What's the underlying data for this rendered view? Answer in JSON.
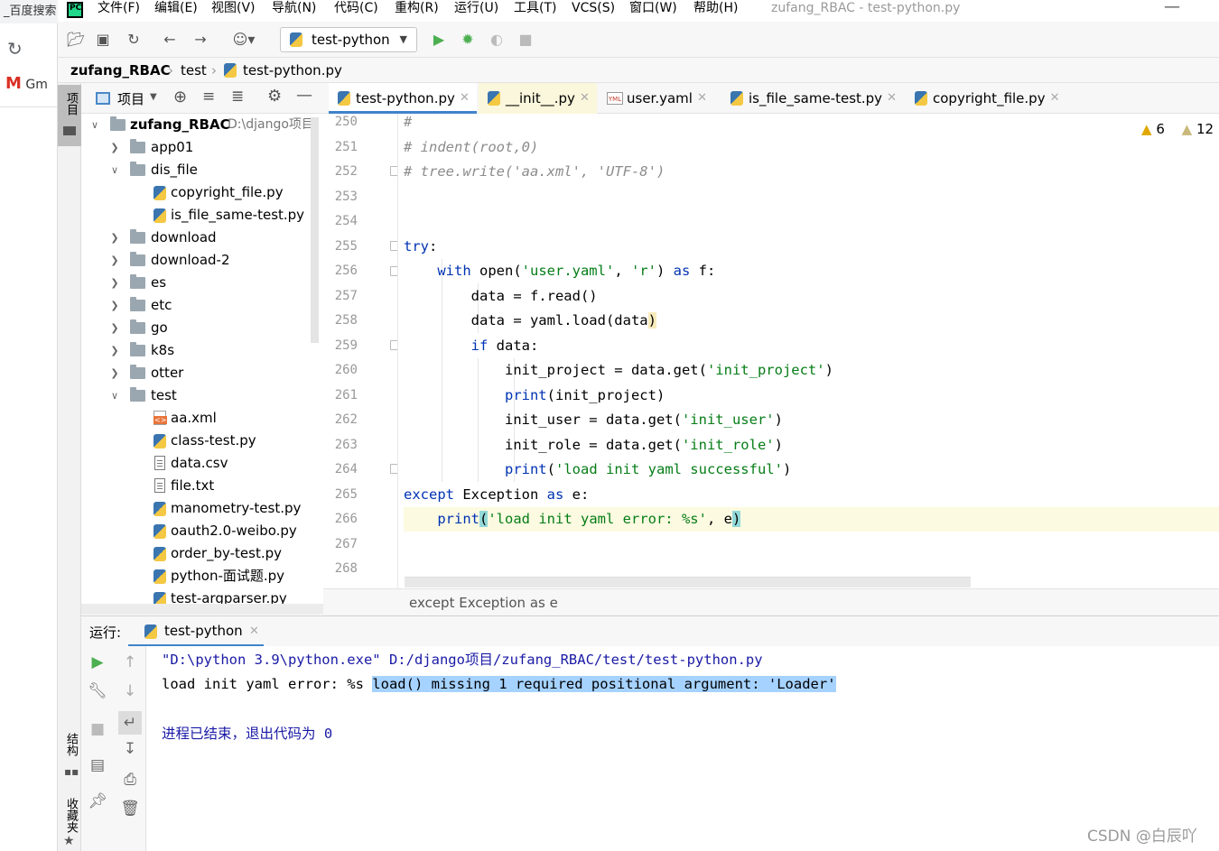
{
  "browser": {
    "tab_text": "_百度搜索",
    "bookmark_text": "Gm"
  },
  "menubar": {
    "items": [
      "文件(F)",
      "编辑(E)",
      "视图(V)",
      "导航(N)",
      "代码(C)",
      "重构(R)",
      "运行(U)",
      "工具(T)",
      "VCS(S)",
      "窗口(W)",
      "帮助(H)"
    ],
    "title": "zufang_RBAC - test-python.py"
  },
  "toolbar": {
    "run_config": "test-python"
  },
  "breadcrumb": {
    "project": "zufang_RBAC",
    "folder": "test",
    "file": "test-python.py"
  },
  "side_strip": {
    "project_label": "项目",
    "structure_label": "结构",
    "favorites_label": "收藏夹"
  },
  "project_panel": {
    "header": "项目",
    "root_name": "zufang_RBAC",
    "root_path": "D:\\django项目",
    "items": [
      {
        "name": "app01"
      },
      {
        "name": "dis_file"
      },
      {
        "name": "copyright_file.py"
      },
      {
        "name": "is_file_same-test.py"
      },
      {
        "name": "download"
      },
      {
        "name": "download-2"
      },
      {
        "name": "es"
      },
      {
        "name": "etc"
      },
      {
        "name": "go"
      },
      {
        "name": "k8s"
      },
      {
        "name": "otter"
      },
      {
        "name": "test"
      },
      {
        "name": "aa.xml"
      },
      {
        "name": "class-test.py"
      },
      {
        "name": "data.csv"
      },
      {
        "name": "file.txt"
      },
      {
        "name": "manometry-test.py"
      },
      {
        "name": "oauth2.0-weibo.py"
      },
      {
        "name": "order_by-test.py"
      },
      {
        "name": "python-面试题.py"
      },
      {
        "name": "test-argparser.py"
      }
    ]
  },
  "editor": {
    "tabs": [
      "test-python.py",
      "__init__.py",
      "user.yaml",
      "is_file_same-test.py",
      "copyright_file.py"
    ],
    "warnings": "6",
    "weak_warnings": "12",
    "line_numbers": [
      "250",
      "251",
      "252",
      "253",
      "254",
      "255",
      "256",
      "257",
      "258",
      "259",
      "260",
      "261",
      "262",
      "263",
      "264",
      "265",
      "266",
      "267",
      "268"
    ],
    "code": {
      "l250": "#",
      "l251": "# indent(root,0)",
      "l252": "# tree.write('aa.xml', 'UTF-8')",
      "l255_kw": "try",
      "l255_rest": ":",
      "l256_kw": "with",
      "l256_a": " open(",
      "l256_s1": "'user.yaml'",
      "l256_b": ", ",
      "l256_s2": "'r'",
      "l256_c": ") ",
      "l256_kw2": "as",
      "l256_d": " f:",
      "l257": "data = f.read()",
      "l258_a": "data = yaml.load(data",
      "l258_b": ")",
      "l259_kw": "if",
      "l259_rest": " data:",
      "l260_a": "init_project = data.get(",
      "l260_s": "'init_project'",
      "l260_b": ")",
      "l261_kw": "print",
      "l261_rest": "(init_project)",
      "l262_a": "init_user = data.get(",
      "l262_s": "'init_user'",
      "l262_b": ")",
      "l263_a": "init_role = data.get(",
      "l263_s": "'init_role'",
      "l263_b": ")",
      "l264_kw": "print",
      "l264_a": "(",
      "l264_s": "'load init yaml successful'",
      "l264_b": ")",
      "l265_kw": "except",
      "l265_a": " Exception ",
      "l265_kw2": "as",
      "l265_b": " e:",
      "l266_kw": "print",
      "l266_p1": "(",
      "l266_s": "'load init yaml error: %s'",
      "l266_a": ", e",
      "l266_p2": ")"
    },
    "status_breadcrumb": "except Exception as e"
  },
  "run_panel": {
    "label": "运行:",
    "tab": "test-python",
    "console": {
      "line1": "\"D:\\python 3.9\\python.exe\" D:/django项目/zufang_RBAC/test/test-python.py",
      "line2_prefix": "load init yaml error: %s ",
      "line2_selected": "load() missing 1 required positional argument: 'Loader'",
      "line4": "进程已结束，退出代码为 0"
    }
  },
  "watermark": "CSDN @白辰吖",
  "colors": {
    "keyword": "#0033b3",
    "string": "#067d17",
    "comment": "#8c8c8c",
    "selection": "#a6d2ff",
    "run_green": "#4caf50",
    "active_tab_underline": "#4083c9"
  }
}
